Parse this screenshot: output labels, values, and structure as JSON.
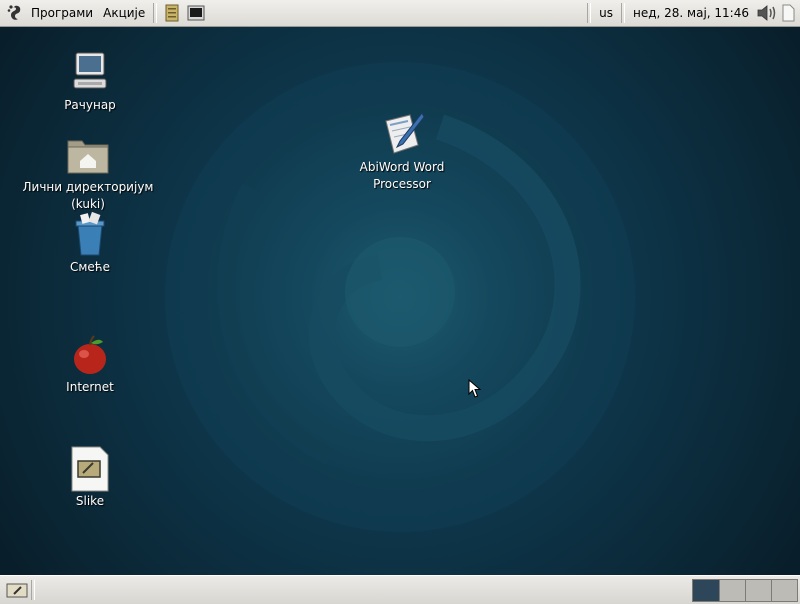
{
  "top_panel": {
    "menus": {
      "applications": "Програми",
      "actions": "Акције"
    },
    "keyboard_layout": "us",
    "clock": "нед, 28. мај, 11:46"
  },
  "desktop": {
    "icons": {
      "computer": "Рачунар",
      "home": "Лични директоријум",
      "home_sub": "(kuki)",
      "trash": "Смеће",
      "internet": "Internet",
      "slike": "Slike",
      "abiword_line1": "AbiWord Word",
      "abiword_line2": "Processor"
    }
  },
  "bottom_panel": {
    "workspaces": 4,
    "active_workspace": 1
  },
  "colors": {
    "panel": "#dcdad5",
    "desktop_bg": "#0d3346",
    "active_workspace": "#2d4659"
  }
}
